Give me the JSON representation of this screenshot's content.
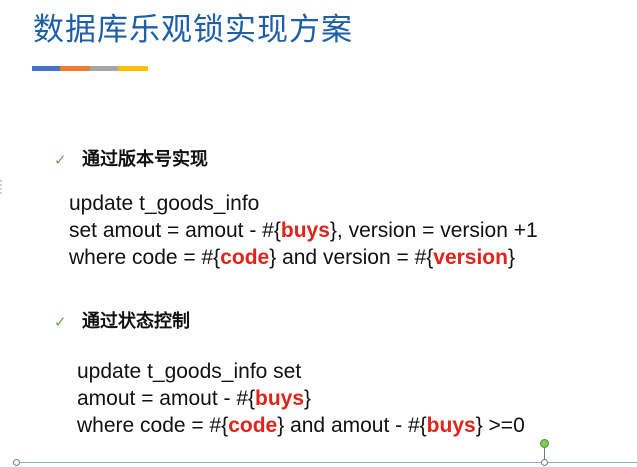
{
  "title": "数据库乐观锁实现方案",
  "accent_colors": [
    "#4472c4",
    "#ed7d31",
    "#a5a5a5",
    "#ffc000"
  ],
  "check_icon": "checkmark-icon",
  "sections": [
    {
      "heading": "通过版本号实现",
      "lines": [
        {
          "text": "update t_goods_info"
        },
        {
          "pre": "set amout = amout - #{",
          "hl1": "buys",
          "mid": "}, version = version +1"
        },
        {
          "pre": "where code = #{",
          "hl1": "code",
          "mid": "} and version = #{",
          "hl2": "version",
          "post": "}"
        }
      ]
    },
    {
      "heading": "通过状态控制",
      "lines": [
        {
          "text": "update t_goods_info set"
        },
        {
          "pre": "amout = amout - #{",
          "hl1": "buys",
          "mid": "}"
        },
        {
          "pre": "where code = #{",
          "hl1": "code",
          "mid": "} and amout - #{",
          "hl2": "buys",
          "post": "} >=0"
        }
      ]
    }
  ]
}
